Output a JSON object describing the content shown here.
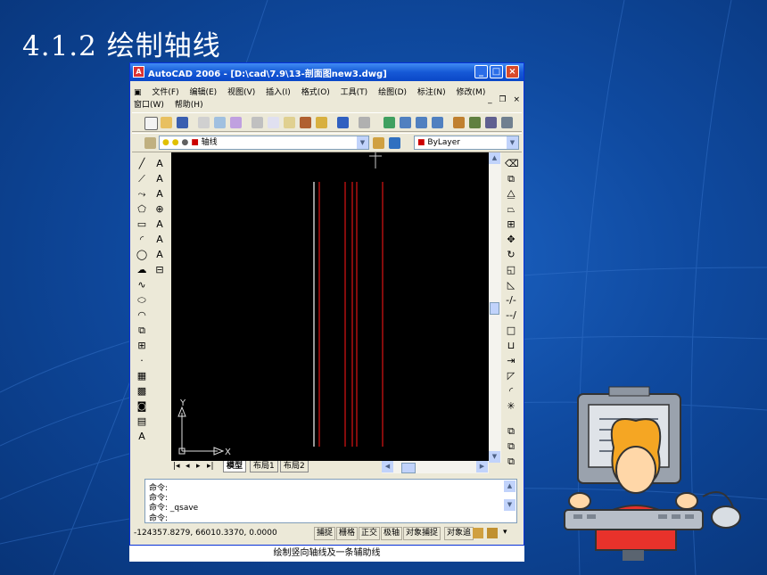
{
  "slide": {
    "title": "4.1.2 绘制轴线",
    "caption": "绘制竖向轴线及一条辅助线"
  },
  "window": {
    "title": "AutoCAD 2006 - [D:\\cad\\7.9\\13-剖面图new3.dwg]",
    "app_icon": "autocad-icon",
    "controls": [
      "minimize",
      "maximize",
      "close"
    ]
  },
  "menubar": {
    "row1": [
      "文件(F)",
      "编辑(E)",
      "视图(V)",
      "插入(I)",
      "格式(O)",
      "工具(T)",
      "绘图(D)",
      "标注(N)",
      "修改(M)"
    ],
    "row2": [
      "窗口(W)",
      "帮助(H)"
    ],
    "mdi_controls": [
      "_",
      "❐",
      "×"
    ]
  },
  "layer_toolbar": {
    "layer_name": "轴线",
    "color_value": "ByLayer",
    "layer_color": "#cc0000"
  },
  "drawing": {
    "background": "#000000",
    "axis_line_color": "#b01010",
    "aux_line_color": "#c8c8c8",
    "ucs_x_label": "X",
    "ucs_y_label": "Y"
  },
  "tabs": {
    "nav": [
      "|◂",
      "◂",
      "▸",
      "▸|"
    ],
    "items": [
      "模型",
      "布局1",
      "布局2"
    ],
    "active": "模型"
  },
  "command_window": {
    "lines": [
      {
        "prefix": "命令:",
        "text": ""
      },
      {
        "prefix": "命令:",
        "text": ""
      },
      {
        "prefix": "命令:",
        "text": "_qsave"
      },
      {
        "prefix": "命令:",
        "text": ""
      }
    ]
  },
  "statusbar": {
    "coordinates": "-124357.8279, 66010.3370, 0.0000",
    "buttons": [
      "捕捉",
      "栅格",
      "正交",
      "极轴",
      "对象捕捉",
      "对象追"
    ]
  },
  "colors": {
    "slide_bg": "#0f4aa0",
    "titlebar": "#1659d6",
    "chrome": "#ece9d8"
  }
}
